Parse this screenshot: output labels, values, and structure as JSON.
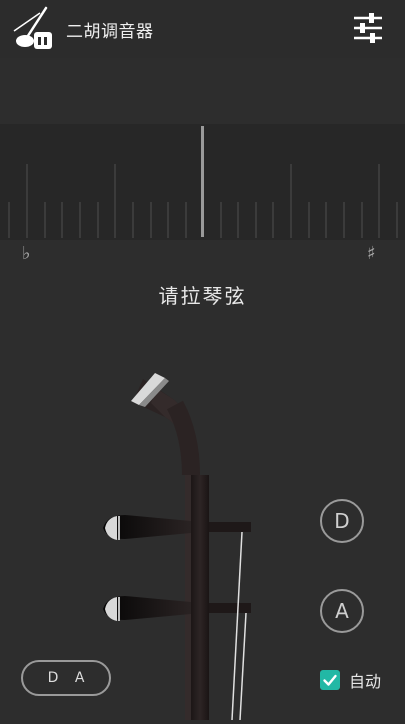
{
  "header": {
    "title": "二胡调音器",
    "logo_icon": "erhu-logo-icon",
    "settings_icon": "sliders-icon"
  },
  "meter": {
    "flat_symbol": "♭",
    "sharp_symbol": "♯"
  },
  "instruction": "请拉琴弦",
  "strings": {
    "d_label": "D",
    "a_label": "A"
  },
  "tuning_label": "D A",
  "auto": {
    "label": "自动",
    "checked": true
  },
  "colors": {
    "background": "#2d2d2d",
    "accent": "#22b8a5",
    "outline": "#9a9a9a"
  }
}
